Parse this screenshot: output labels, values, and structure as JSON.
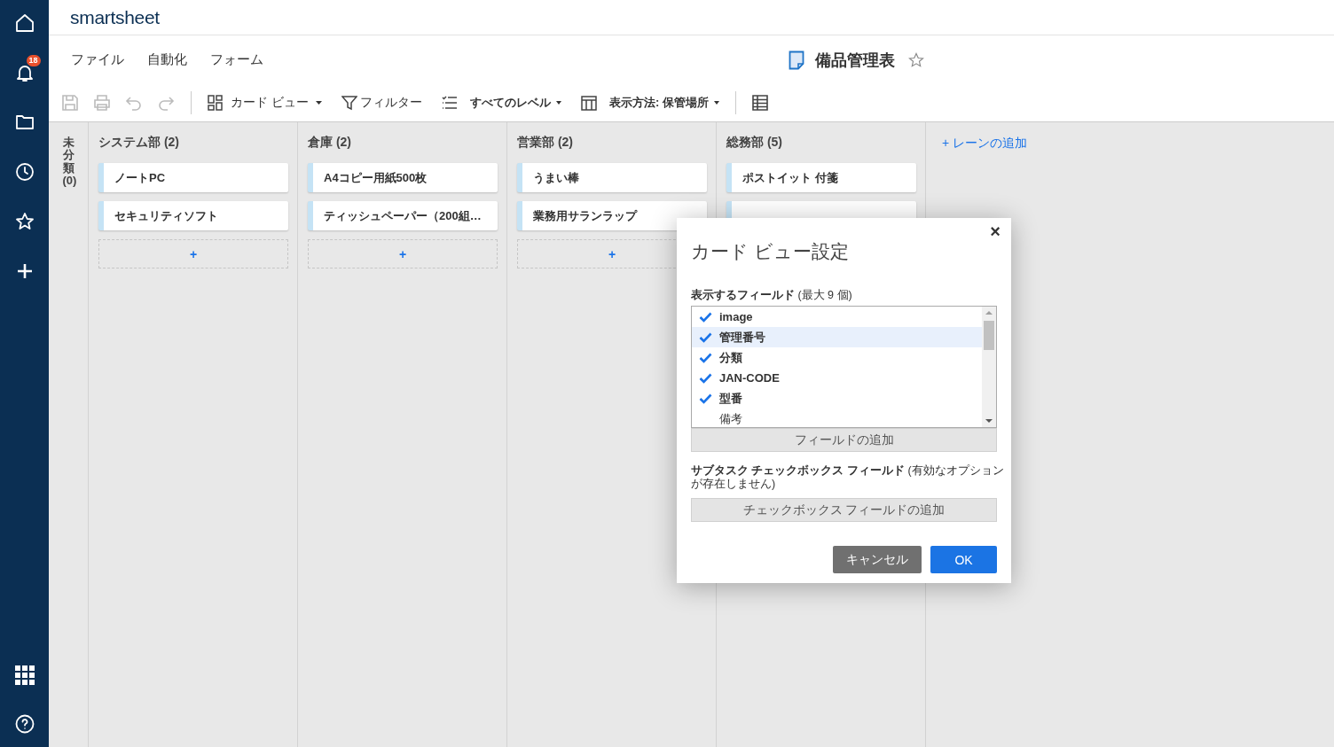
{
  "sidebar": {
    "notification_badge": "18"
  },
  "logo": "smartsheet",
  "menu": [
    "ファイル",
    "自動化",
    "フォーム"
  ],
  "sheet": {
    "title": "備品管理表",
    "favorite": false
  },
  "toolbar": {
    "view_mode": "カード ビュー",
    "filter": "フィルター",
    "levels": "すべてのレベル",
    "group_by": "表示方法: 保管場所"
  },
  "uncategorized": "未分類 (0)",
  "lanes": [
    {
      "title": "システム部 (2)",
      "cards": [
        {
          "kind": "text",
          "title": "ノートPC"
        },
        {
          "kind": "text",
          "title": "セキュリティソフト"
        }
      ],
      "add_card": "+"
    },
    {
      "title": "倉庫 (2)",
      "cards": [
        {
          "kind": "text",
          "title": "A4コピー用紙500枚"
        },
        {
          "kind": "text",
          "title": "ティッシュペーパー（200組…"
        }
      ],
      "add_card": "+"
    },
    {
      "title": "営業部 (2)",
      "cards": [
        {
          "kind": "text",
          "title": "うまい棒"
        },
        {
          "kind": "text",
          "title": "業務用サランラップ"
        }
      ],
      "add_card": "+"
    },
    {
      "title": "総務部 (5)",
      "cards": [
        {
          "kind": "text",
          "title": "ポストイット 付箋"
        },
        {
          "kind": "covered"
        }
      ]
    }
  ],
  "add_lane": "+ レーンの追加",
  "dialog": {
    "close": "×",
    "title": "カード ビュー設定",
    "fields_label": "**表示するフィールド** (最大 9 個)",
    "fields": [
      {
        "name": "image",
        "checked": true,
        "selected": false
      },
      {
        "name": "管理番号",
        "checked": true,
        "selected": true
      },
      {
        "name": "分類",
        "checked": true,
        "selected": false
      },
      {
        "name": "JAN-CODE",
        "checked": true,
        "selected": false
      },
      {
        "name": "型番",
        "checked": true,
        "selected": false
      },
      {
        "name": "備考",
        "checked": false,
        "selected": false
      }
    ],
    "add_field": "フィールドの追加",
    "subtask_label": "**サブタスク チェックボックス フィールド** (有効なオプションが存在しません)",
    "add_checkbox": "チェックボックス フィールドの追加",
    "cancel": "キャンセル",
    "ok": "OK"
  }
}
